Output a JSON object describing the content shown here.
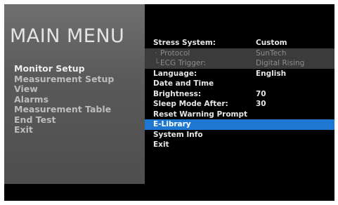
{
  "main_menu": {
    "title": "MAIN MENU",
    "items": [
      {
        "label": "Monitor Setup"
      },
      {
        "label": "Measurement Setup"
      },
      {
        "label": "View"
      },
      {
        "label": "Alarms"
      },
      {
        "label": "Measurement Table"
      },
      {
        "label": "End Test"
      },
      {
        "label": "Exit"
      }
    ],
    "active_item": "Monitor Setup"
  },
  "submenu": {
    "items": [
      {
        "label": "Stress System:",
        "value": "Custom"
      },
      {
        "label": "Protocol",
        "value": "SunTech"
      },
      {
        "label": "ECG Trigger:",
        "value": "Digital Rising"
      },
      {
        "label": "Language:",
        "value": "English"
      },
      {
        "label": "Date and Time",
        "value": ""
      },
      {
        "label": "Brightness:",
        "value": "70"
      },
      {
        "label": "Sleep Mode After:",
        "value": "30"
      },
      {
        "label": "Reset Warning Prompt",
        "value": ""
      },
      {
        "label": "E-Library",
        "value": ""
      },
      {
        "label": "System Info",
        "value": ""
      },
      {
        "label": "Exit",
        "value": ""
      }
    ],
    "selected_item": "E-Library"
  },
  "colors": {
    "highlight": "#1e78d2",
    "screen_background": "#000000",
    "left_panel": "#5a5a5a"
  }
}
